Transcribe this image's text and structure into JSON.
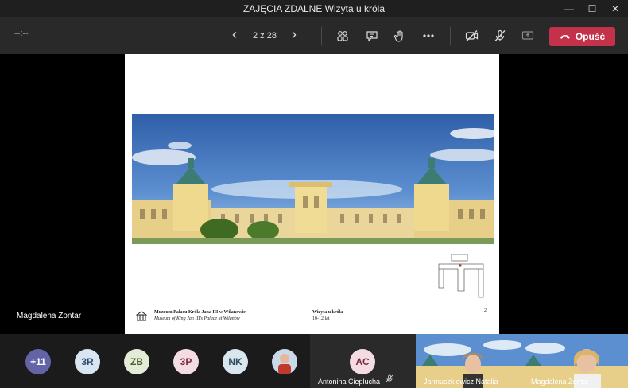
{
  "window": {
    "title": "ZAJĘCIA ZDALNE Wizyta u króla"
  },
  "toolbar": {
    "timer": "--:--",
    "page_indicator": "2 z 28",
    "leave_label": "Opuść"
  },
  "stage": {
    "presenter_name": "Magdalena Zontar"
  },
  "slide": {
    "footer_museum_pl": "Muzeum Pałacu Króla Jana III w Wilanowie",
    "footer_museum_en": "Museum of King Jan III's Palace at Wilanów",
    "footer_title": "Wizyta u króla",
    "footer_age": "10-12 lat",
    "page_number": "2"
  },
  "participants": {
    "overflow": "+11",
    "avatars": [
      {
        "initials": "3R",
        "bg": "#d8e6f3",
        "fg": "#2e4b6b"
      },
      {
        "initials": "ZB",
        "bg": "#e4ecd6",
        "fg": "#4b5e2f"
      },
      {
        "initials": "3P",
        "bg": "#f3dde3",
        "fg": "#7a2a3e"
      },
      {
        "initials": "NK",
        "bg": "#d9e6ee",
        "fg": "#2b4d5e"
      }
    ],
    "tiles": [
      {
        "initials": "AC",
        "name": "Antonina Cieplucha"
      },
      {
        "name": "Jarmuszkiewicz Natalia"
      },
      {
        "name": "Magdalena Zontar"
      }
    ]
  },
  "colors": {
    "leave_button": "#c4314b",
    "toolbar_bg": "#292929",
    "overflow_badge": "#6264a7"
  }
}
